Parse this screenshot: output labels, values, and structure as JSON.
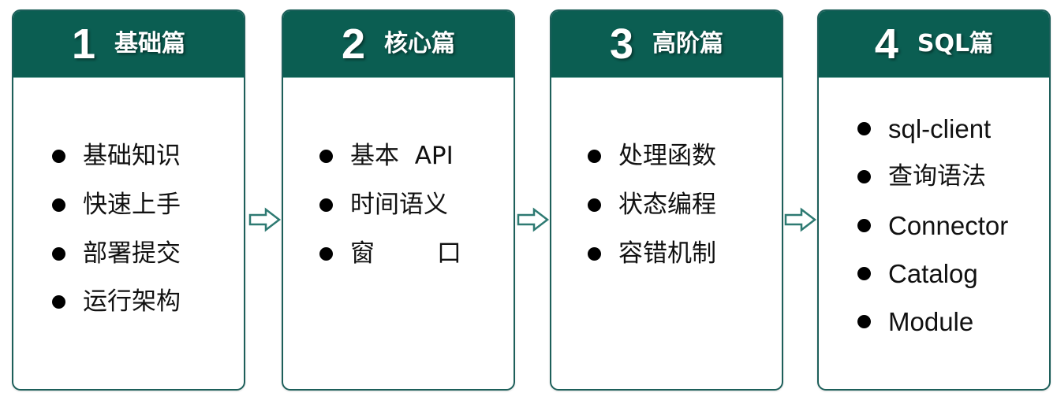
{
  "diagram": {
    "cards": [
      {
        "number": "1",
        "title": "基础篇",
        "items": [
          "基础知识",
          "快速上手",
          "部署提交",
          "运行架构"
        ]
      },
      {
        "number": "2",
        "title": "核心篇",
        "items": [
          "基本  API",
          "时间语义",
          "窗        口"
        ]
      },
      {
        "number": "3",
        "title": "高阶篇",
        "items": [
          "处理函数",
          "状态编程",
          "容错机制"
        ]
      },
      {
        "number": "4",
        "title": "SQL篇",
        "items": [
          "sql-client",
          "查询语法",
          "Connector",
          "Catalog",
          "Module"
        ]
      }
    ],
    "arrows": [
      "right-arrow",
      "right-arrow",
      "right-arrow"
    ],
    "colors": {
      "header": "#0b5e52",
      "border": "#1d5f5a",
      "arrow": "#2e7a72"
    }
  }
}
